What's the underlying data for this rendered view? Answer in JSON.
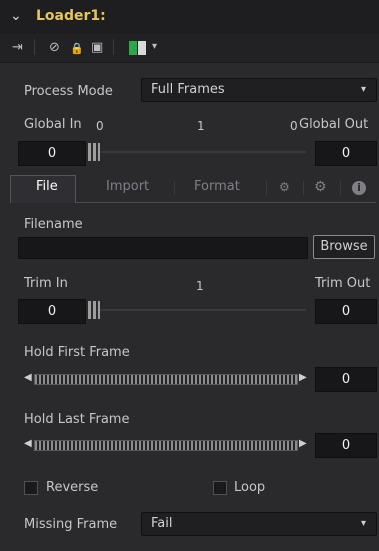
{
  "node": {
    "title": "Loader1:",
    "collapse_glyph": "⌄"
  },
  "toolbar": {
    "pin_glyph": "⇥",
    "disable_glyph": "⊘",
    "lock_glyph": "🔒",
    "save_glyph": "▣",
    "color_swatch": "#2aa84a",
    "dropdown_glyph": "▾"
  },
  "process_mode": {
    "label": "Process Mode",
    "value": "Full Frames"
  },
  "global": {
    "in_label": "Global In",
    "out_label": "Global Out",
    "in_small": "0",
    "mid_small": "1",
    "out_small": "0",
    "in_value": "0",
    "out_value": "0"
  },
  "tabs": {
    "file": "File",
    "import": "Import",
    "format": "Format",
    "icons": [
      "gear-small-icon",
      "gear-icon",
      "info-icon"
    ]
  },
  "filename": {
    "label": "Filename",
    "value": "",
    "browse": "Browse"
  },
  "trim": {
    "in_label": "Trim In",
    "out_label": "Trim Out",
    "mid": "1",
    "in_value": "0",
    "out_value": "0"
  },
  "hold_first": {
    "label": "Hold First Frame",
    "value": "0"
  },
  "hold_last": {
    "label": "Hold Last Frame",
    "value": "0"
  },
  "reverse": {
    "label": "Reverse"
  },
  "loop": {
    "label": "Loop"
  },
  "missing_frames": {
    "label": "Missing Frame",
    "value": "Fail"
  }
}
